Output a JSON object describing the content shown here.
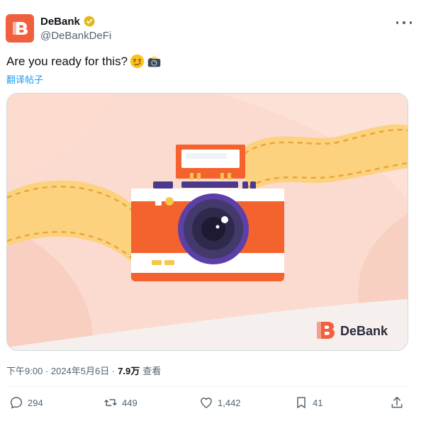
{
  "tweet": {
    "author_name": "DeBank",
    "author_handle": "@DeBankDeFi",
    "text": "Are you ready for this?",
    "translate_label": "翻译帖子",
    "timestamp": "下午9:00 · 2024年5月6日 ·",
    "views_count": "7.9万",
    "views_label": "查看"
  },
  "media": {
    "brand_label": "DeBank",
    "brand_color": "#f0603f"
  },
  "actions": {
    "replies": "294",
    "retweets": "449",
    "likes": "1,442",
    "bookmarks": "41"
  },
  "icons": [
    "debank-logo-icon",
    "verified-badge-icon",
    "more-icon",
    "smirk-emoji-icon",
    "camera-flash-emoji-icon",
    "reply-icon",
    "retweet-icon",
    "like-icon",
    "bookmark-icon",
    "share-icon"
  ]
}
